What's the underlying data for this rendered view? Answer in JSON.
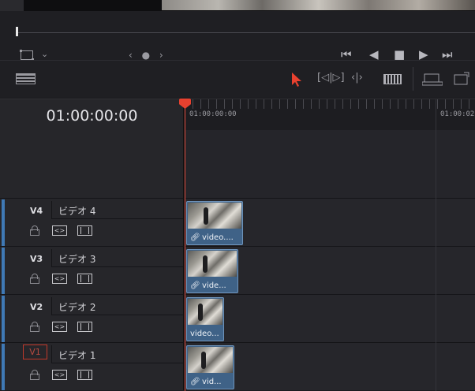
{
  "transport": {
    "nav_dots": "‹ ● ›",
    "view_chevron": "⌄",
    "controls": [
      "⏮",
      "◀",
      "■",
      "▶",
      "⏭"
    ]
  },
  "toolbar": {
    "trim_icon": "[◁|▷]",
    "dynamic_trim_icon": "‹|›",
    "pointer_color": "#e8412f"
  },
  "timeline": {
    "timecode": "01:00:00:00",
    "ruler_labels": [
      "01:00:00:00",
      "01:00:02"
    ]
  },
  "tracks": [
    {
      "id": "V4",
      "name": "ビデオ 4",
      "clip_label": "video...."
    },
    {
      "id": "V3",
      "name": "ビデオ 3",
      "clip_label": "vide..."
    },
    {
      "id": "V2",
      "name": "ビデオ 2",
      "clip_label": "video..."
    },
    {
      "id": "V1",
      "name": "ビデオ 1",
      "clip_label": "vid..."
    }
  ],
  "track_icons": {
    "auto": "<>"
  },
  "colors": {
    "playhead": "#e8412f",
    "track_accent": "#3f79b5",
    "clip": "#3f6287",
    "active_track_border": "#c0392b"
  }
}
